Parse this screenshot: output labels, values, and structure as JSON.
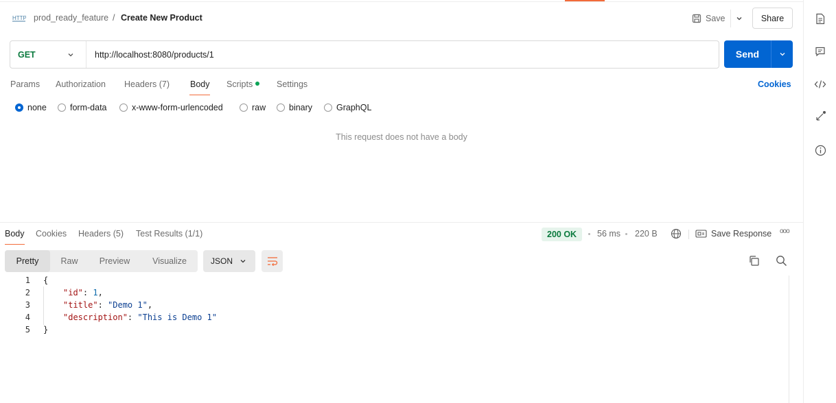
{
  "header": {
    "breadcrumb_parent": "prod_ready_feature",
    "breadcrumb_sep": "/",
    "title": "Create New Product",
    "save_label": "Save",
    "share_label": "Share"
  },
  "request": {
    "method": "GET",
    "url": "http://localhost:8080/products/1",
    "send_label": "Send",
    "tabs": {
      "params": "Params",
      "authorization": "Authorization",
      "headers": "Headers (7)",
      "body": "Body",
      "scripts": "Scripts",
      "settings": "Settings"
    },
    "active_tab": "Body",
    "cookies_label": "Cookies",
    "body_modes": {
      "none": "none",
      "form_data": "form-data",
      "urlencoded": "x-www-form-urlencoded",
      "raw": "raw",
      "binary": "binary",
      "graphql": "GraphQL"
    },
    "selected_body_mode": "none",
    "empty_body_message": "This request does not have a body"
  },
  "response": {
    "tabs": {
      "body": "Body",
      "cookies": "Cookies",
      "headers": "Headers (5)",
      "test_results": "Test Results (1/1)"
    },
    "status": "200 OK",
    "time": "56 ms",
    "size": "220 B",
    "save_response_label": "Save Response",
    "more_label": "ooo",
    "views": {
      "pretty": "Pretty",
      "raw": "Raw",
      "preview": "Preview",
      "visualize": "Visualize"
    },
    "active_view": "Pretty",
    "format": "JSON",
    "code_lines": {
      "n1": "1",
      "n2": "2",
      "n3": "3",
      "n4": "4",
      "n5": "5",
      "open": "{",
      "id_key": "\"id\"",
      "id_val": "1",
      "title_key": "\"title\"",
      "title_val": "\"Demo 1\"",
      "desc_key": "\"description\"",
      "desc_val": "\"This is Demo 1\"",
      "close": "}"
    }
  },
  "colors": {
    "accent": "#f26b3a",
    "primary": "#0265d2",
    "method_get": "#0b7a3e",
    "status_ok_bg": "#e6f4ec"
  }
}
